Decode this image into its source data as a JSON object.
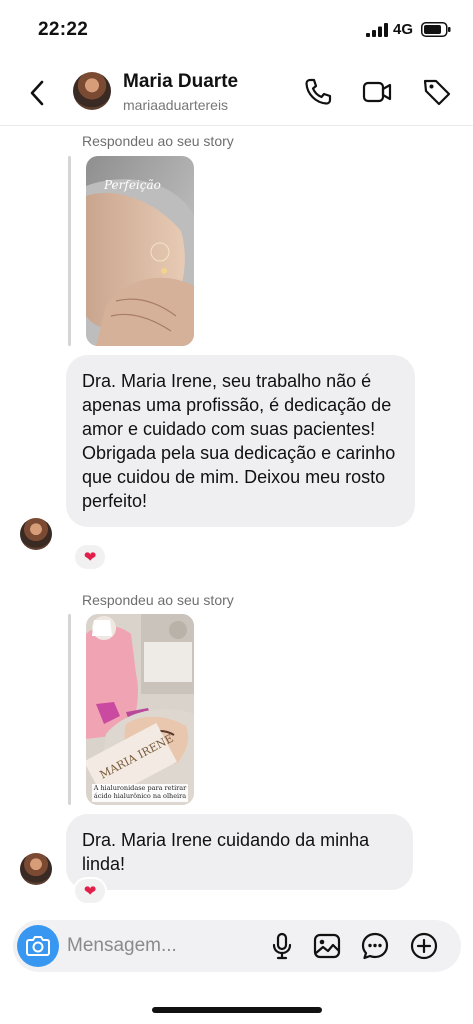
{
  "status_bar": {
    "time": "22:22",
    "network": "4G"
  },
  "header": {
    "name": "Maria Duarte",
    "handle": "mariaaduartereis"
  },
  "messages": [
    {
      "caption": "Respondeu ao seu story",
      "story_text": "Perfeição",
      "paragraphs": [
        "Dra. Maria Irene, seu trabalho não é apenas uma profissão, é dedicação de amor e cuidado com suas pacientes!",
        "Obrigada pela sua dedicação e carinho  que cuidou de mim. Deixou meu rosto perfeito!"
      ],
      "reaction": "❤"
    },
    {
      "caption": "Respondeu ao seu story",
      "story_text": "A hialuronidase para retirar ácido hialurônico na olheira",
      "story_card_text": "MARIA IRENE",
      "paragraphs": [
        "Dra. Maria Irene cuidando da minha linda!"
      ],
      "reaction": "❤"
    }
  ],
  "composer": {
    "placeholder": "Mensagem..."
  },
  "icons": {
    "back": "chevron-left-icon",
    "call": "phone-icon",
    "video": "video-camera-icon",
    "tag": "tag-icon",
    "camera": "camera-icon",
    "mic": "microphone-icon",
    "gallery": "image-icon",
    "sticker": "chat-bubble-icon",
    "add": "plus-circle-icon"
  },
  "colors": {
    "accent": "#3897f0",
    "bubble": "#efeff1",
    "heart": "#e3204a"
  }
}
